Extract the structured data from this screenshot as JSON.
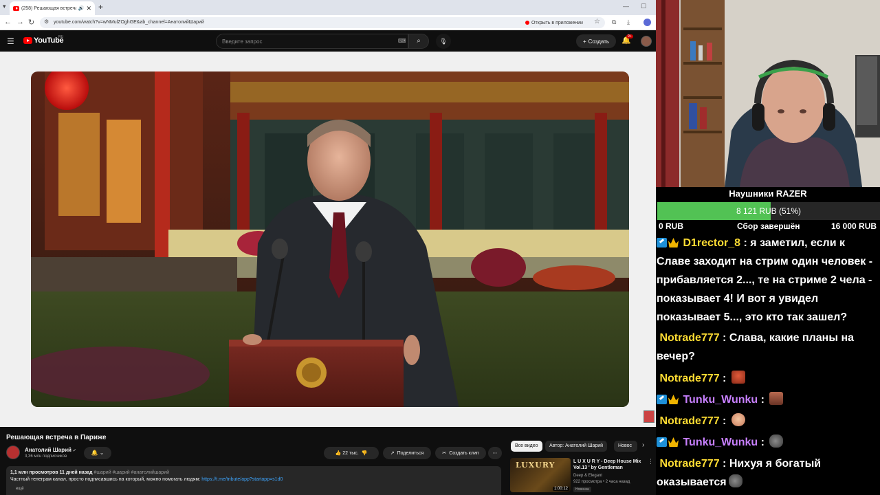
{
  "browser": {
    "tab_title": "(258) Решающая встреча в",
    "url": "youtube.com/watch?v=wNMulZOghGE&ab_channel=АнатолийШарий",
    "open_in_app": "Открыть в приложении"
  },
  "youtube": {
    "wordmark": "YouTube",
    "region": "RU",
    "search_placeholder": "Введите запрос",
    "create_label": "Создать",
    "notif_count": "9+"
  },
  "video": {
    "title": "Решающая встреча в Париже",
    "channel": "Анатолий Шарий",
    "subscribers": "3,36 млн подписчиков",
    "likes": "22 тыс.",
    "share_label": "Поделиться",
    "clip_label": "Создать клип",
    "views_date": "1,1 млн просмотров  11 дней назад",
    "tags": "#шарий #шарий #анатолийшарий",
    "desc_text": "Частный телеграм канал, просто подписавшись на который, можно помогать людям:",
    "desc_link": "https://t.me/tribute/app?startapp=s1d0",
    "desc_more": "ещё"
  },
  "sidebar": {
    "chips": [
      "Все видео",
      "Автор: Анатолий Шарий",
      "Новос"
    ],
    "rec": {
      "thumb_text": "LUXURY",
      "duration": "1:00:12",
      "title": "L U X U R Y - Deep House Mix Vol.13 ' by Gentleman",
      "channel": "Deep & Elegant",
      "meta": "922 просмотра • 2 часа назад",
      "badge": "Новинка"
    }
  },
  "stream": {
    "goal": {
      "title": "Наушники RAZER",
      "amount_text": "8 121 RUB (51%)",
      "progress": 0.51,
      "min": "0 RUB",
      "status": "Сбор завершён",
      "max": "16 000 RUB"
    },
    "chat": [
      {
        "user": "D1rector_8",
        "text": "я заметил, если к Славе заходит на стрим один человек - прибавляется 2..., те на стриме 2 чела - показывает 4! И вот я увидел показывает 5..., это кто так зашел?"
      },
      {
        "user": "Notrade777",
        "text": "Слава, какие планы на вечер?"
      },
      {
        "user": "Notrade777",
        "text": ""
      },
      {
        "user": "Tunku_Wunku",
        "text": ""
      },
      {
        "user": "Notrade777",
        "text": ""
      },
      {
        "user": "Tunku_Wunku",
        "text": ""
      },
      {
        "user": "Notrade777",
        "text": "Нихуя я богатый оказывается"
      }
    ]
  }
}
